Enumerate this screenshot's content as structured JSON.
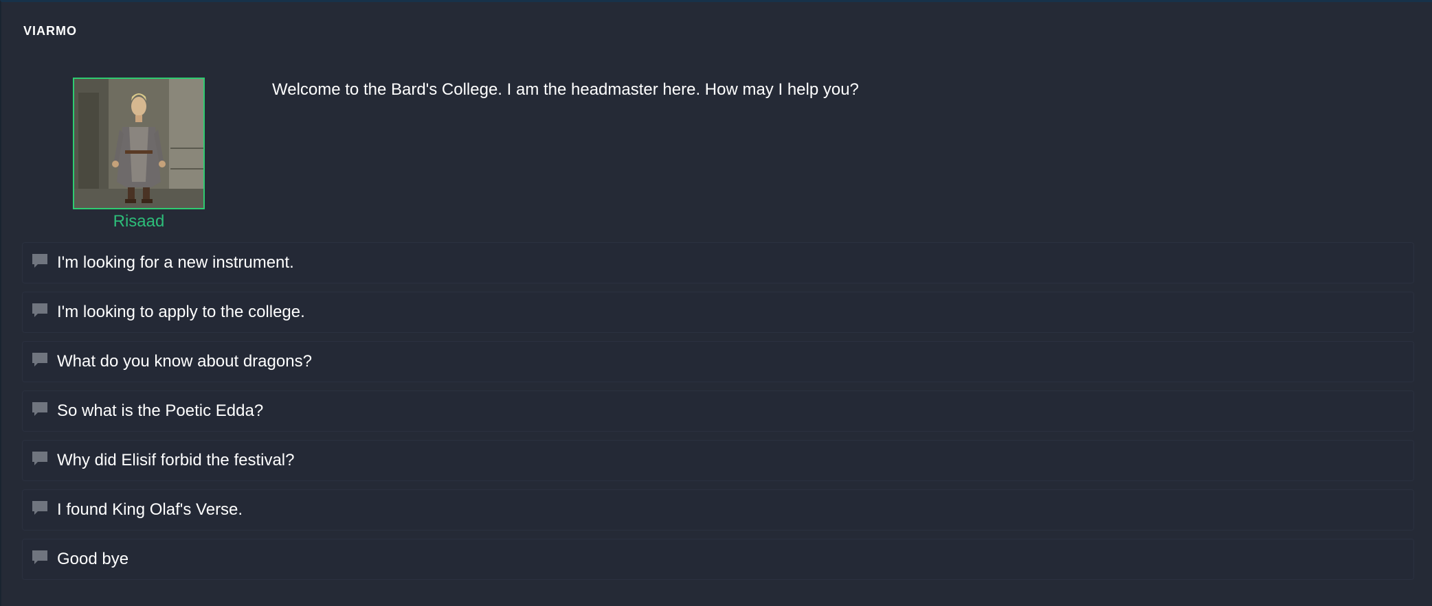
{
  "window": {
    "title": "VIARMO"
  },
  "speaker": {
    "name": "Risaad",
    "portrait_icon": "npc-portrait",
    "name_color": "#2dbd79"
  },
  "dialogue": {
    "text": "Welcome to the Bard's College. I am the headmaster here. How may I help you?"
  },
  "options": [
    {
      "label": "I'm looking for a new instrument.",
      "icon": "speech-bubble-icon"
    },
    {
      "label": "I'm looking to apply to the college.",
      "icon": "speech-bubble-icon"
    },
    {
      "label": "What do you know about dragons?",
      "icon": "speech-bubble-icon"
    },
    {
      "label": "So what is the Poetic Edda?",
      "icon": "speech-bubble-icon"
    },
    {
      "label": "Why did Elisif forbid the festival?",
      "icon": "speech-bubble-icon"
    },
    {
      "label": "I found King Olaf's Verse.",
      "icon": "speech-bubble-icon"
    },
    {
      "label": "Good bye",
      "icon": "speech-bubble-icon"
    }
  ],
  "colors": {
    "background": "#252a36",
    "accent": "#2ecc71",
    "text": "#ffffff"
  }
}
